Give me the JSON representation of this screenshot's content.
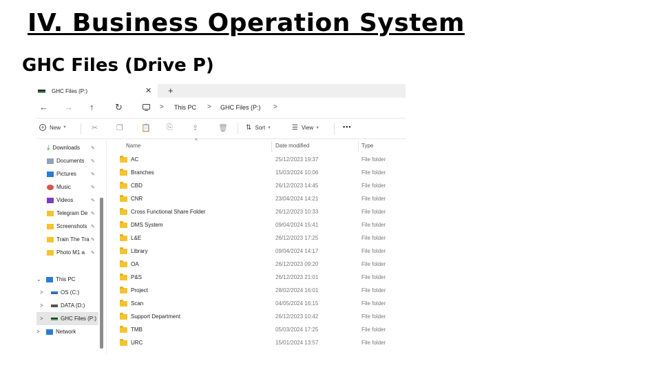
{
  "slide": {
    "title": "IV. Business Operation System",
    "subtitle": "GHC Files (Drive P)"
  },
  "explorer": {
    "tab": {
      "label": "GHC Files (P:)",
      "close_glyph": "✕",
      "new_glyph": "+"
    },
    "nav": {
      "back_glyph": "←",
      "forward_glyph": "→",
      "up_glyph": "↑",
      "refresh_glyph": "↻"
    },
    "breadcrumb": {
      "items": [
        "This PC",
        "GHC Files (P:)"
      ],
      "separator": ">"
    },
    "toolbar": {
      "new_label": "New",
      "sort_label": "Sort",
      "view_label": "View",
      "more_glyph": "•••",
      "icons": [
        "cut-icon",
        "copy-icon",
        "paste-icon",
        "rename-icon",
        "share-icon",
        "delete-icon"
      ]
    },
    "sidebar": {
      "quick_access": [
        {
          "label": "Downloads",
          "icon": "download-icon",
          "pinned": true
        },
        {
          "label": "Documents",
          "icon": "documents-icon",
          "pinned": true
        },
        {
          "label": "Pictures",
          "icon": "pictures-icon",
          "pinned": true
        },
        {
          "label": "Music",
          "icon": "music-icon",
          "pinned": true
        },
        {
          "label": "Videos",
          "icon": "videos-icon",
          "pinned": true
        },
        {
          "label": "Telegram De",
          "icon": "folder-icon",
          "pinned": true
        },
        {
          "label": "Screenshots",
          "icon": "folder-icon",
          "pinned": true
        },
        {
          "label": "Train The Tra",
          "icon": "folder-icon",
          "pinned": true
        },
        {
          "label": "Photo M1 a",
          "icon": "folder-icon",
          "pinned": true
        }
      ],
      "this_pc_label": "This PC",
      "drives": [
        {
          "label": "OS (C:)",
          "icon": "windows-drive-icon",
          "selected": false
        },
        {
          "label": "DATA (D:)",
          "icon": "drive-icon",
          "selected": false
        },
        {
          "label": "GHC Files (P:)",
          "icon": "network-drive-icon",
          "selected": true
        }
      ],
      "network_label": "Network",
      "pin_glyph": "📌"
    },
    "columns": {
      "name": "Name",
      "date_modified": "Date modified",
      "type": "Type"
    },
    "files": [
      {
        "name": "AC",
        "date": "25/12/2023 19:37",
        "type": "File folder"
      },
      {
        "name": "Branches",
        "date": "15/03/2024 10:06",
        "type": "File folder"
      },
      {
        "name": "CBD",
        "date": "26/12/2023 14:45",
        "type": "File folder"
      },
      {
        "name": "CNR",
        "date": "23/04/2024 14:21",
        "type": "File folder"
      },
      {
        "name": "Cross Functional Share Folder",
        "date": "26/12/2023 10:33",
        "type": "File folder"
      },
      {
        "name": "DMS System",
        "date": "09/04/2024 15:41",
        "type": "File folder"
      },
      {
        "name": "L&E",
        "date": "26/12/2023 17:25",
        "type": "File folder"
      },
      {
        "name": "Library",
        "date": "09/04/2024 14:17",
        "type": "File folder"
      },
      {
        "name": "OA",
        "date": "26/12/2023 09:20",
        "type": "File folder"
      },
      {
        "name": "P&S",
        "date": "26/12/2023 21:01",
        "type": "File folder"
      },
      {
        "name": "Project",
        "date": "28/02/2024 16:01",
        "type": "File folder"
      },
      {
        "name": "Scan",
        "date": "04/05/2024 16:15",
        "type": "File folder"
      },
      {
        "name": "Support Department",
        "date": "26/12/2023 10:42",
        "type": "File folder"
      },
      {
        "name": "TMB",
        "date": "05/03/2024 17:25",
        "type": "File folder"
      },
      {
        "name": "URC",
        "date": "15/01/2024 13:57",
        "type": "File folder"
      }
    ]
  }
}
